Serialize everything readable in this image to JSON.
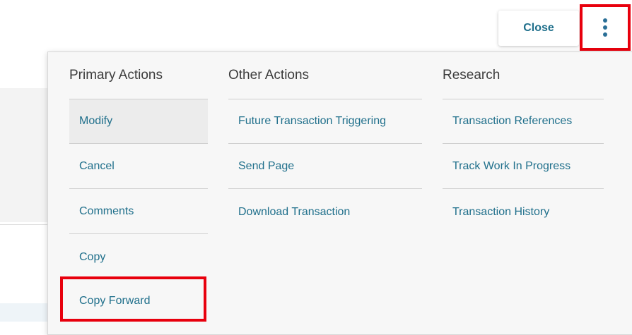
{
  "header": {
    "close_label": "Close"
  },
  "icons": {
    "kebab": "vertical-ellipsis-icon"
  },
  "colors": {
    "link": "#1f6f8b",
    "highlight": "#e8000d",
    "heading": "#3c3c3c"
  },
  "menu": {
    "columns": [
      {
        "heading": "Primary Actions",
        "items": [
          {
            "label": "Modify",
            "active": true
          },
          {
            "label": "Cancel"
          },
          {
            "label": "Comments"
          },
          {
            "label": "Copy"
          },
          {
            "label": "Copy Forward",
            "highlighted": true
          }
        ]
      },
      {
        "heading": "Other Actions",
        "items": [
          {
            "label": "Future Transaction Triggering"
          },
          {
            "label": "Send Page"
          },
          {
            "label": "Download Transaction"
          }
        ]
      },
      {
        "heading": "Research",
        "items": [
          {
            "label": "Transaction References"
          },
          {
            "label": "Track Work In Progress"
          },
          {
            "label": "Transaction History"
          }
        ]
      }
    ]
  }
}
